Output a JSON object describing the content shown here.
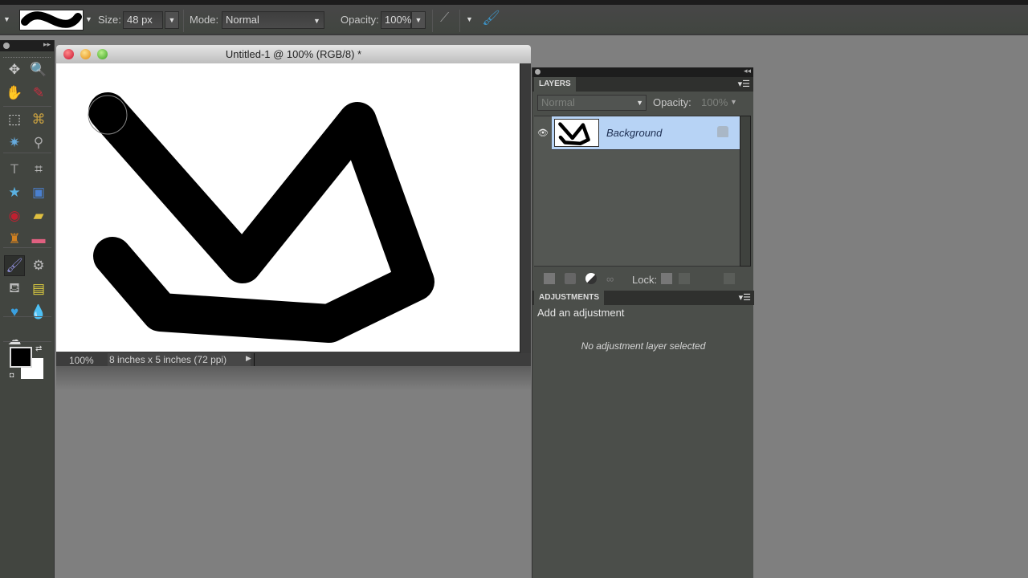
{
  "options_bar": {
    "size_label": "Size:",
    "size_value": "48 px",
    "mode_label": "Mode:",
    "mode_value": "Normal",
    "opacity_label": "Opacity:",
    "opacity_value": "100%"
  },
  "toolbox": {
    "tools": [
      {
        "name": "move-tool",
        "icon": "move-icon",
        "glyph": "✥"
      },
      {
        "name": "zoom-tool",
        "icon": "magnifier-icon",
        "glyph": "🔍"
      },
      {
        "name": "hand-tool",
        "icon": "hand-icon",
        "glyph": "✋"
      },
      {
        "name": "eyedropper-tool",
        "icon": "eyedropper-icon",
        "glyph": "✎"
      },
      {
        "name": "rectangular-marquee-tool",
        "icon": "marquee-icon",
        "glyph": "⬚"
      },
      {
        "name": "lasso-tool",
        "icon": "lasso-icon",
        "glyph": "⌘"
      },
      {
        "name": "magic-wand-tool",
        "icon": "magic-wand-icon",
        "glyph": "✷"
      },
      {
        "name": "quick-selection-tool",
        "icon": "quick-selection-icon",
        "glyph": "⚲"
      },
      {
        "name": "type-tool",
        "icon": "type-icon",
        "glyph": "T"
      },
      {
        "name": "crop-tool",
        "icon": "crop-icon",
        "glyph": "⌗"
      },
      {
        "name": "cookie-cutter-tool",
        "icon": "star-icon",
        "glyph": "★"
      },
      {
        "name": "recompose-tool",
        "icon": "recompose-icon",
        "glyph": "▣"
      },
      {
        "name": "red-eye-tool",
        "icon": "red-eye-icon",
        "glyph": "◉"
      },
      {
        "name": "healing-brush-tool",
        "icon": "bandage-icon",
        "glyph": "▰"
      },
      {
        "name": "clone-stamp-tool",
        "icon": "stamp-icon",
        "glyph": "♜"
      },
      {
        "name": "eraser-tool",
        "icon": "eraser-icon",
        "glyph": "▬"
      },
      {
        "name": "brush-tool",
        "icon": "brush-icon",
        "glyph": "🖌"
      },
      {
        "name": "smart-brush-tool",
        "icon": "smart-brush-icon",
        "glyph": "⚙"
      },
      {
        "name": "paint-bucket-tool",
        "icon": "paint-bucket-icon",
        "glyph": "⛾"
      },
      {
        "name": "gradient-tool",
        "icon": "gradient-icon",
        "glyph": "▤"
      },
      {
        "name": "custom-shape-tool",
        "icon": "heart-icon",
        "glyph": "♥"
      },
      {
        "name": "blur-tool",
        "icon": "water-drop-icon",
        "glyph": "💧"
      },
      {
        "name": "sponge-tool",
        "icon": "sponge-icon",
        "glyph": "☁"
      }
    ],
    "foreground_color": "#000000",
    "background_color": "#ffffff"
  },
  "document": {
    "title": "Untitled-1 @ 100% (RGB/8) *",
    "zoom": "100%",
    "info": "8 inches x 5 inches (72 ppi)"
  },
  "layers_panel": {
    "tab_label": "LAYERS",
    "blend_mode": "Normal",
    "opacity_label": "Opacity:",
    "opacity_value": "100%",
    "layers": [
      {
        "name": "Background",
        "visible": true,
        "locked": true,
        "selected": true
      }
    ],
    "lock_label": "Lock:"
  },
  "adjustments_panel": {
    "tab_label": "ADJUSTMENTS",
    "title": "Add an adjustment",
    "empty_message": "No adjustment layer selected"
  },
  "colors": {
    "selection": "#b7d3f5",
    "panel_bg": "#4b4e4a",
    "workspace": "#7f7f7f"
  }
}
